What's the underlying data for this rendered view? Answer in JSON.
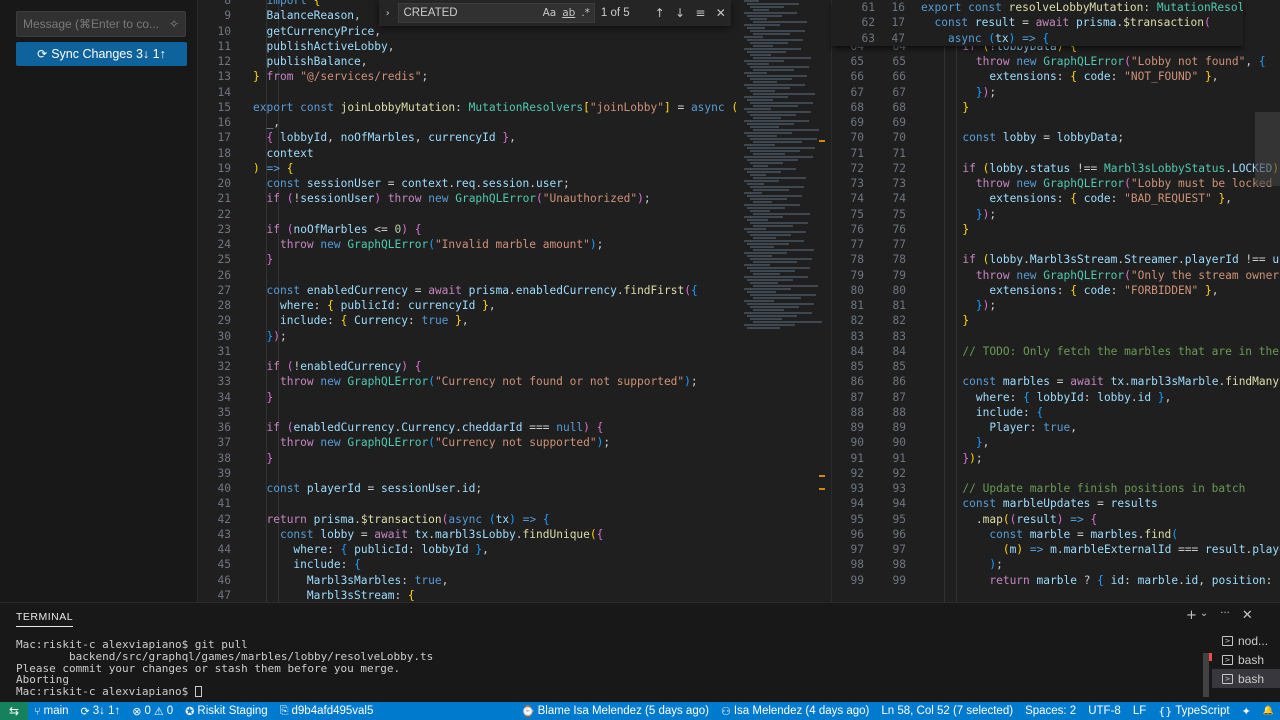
{
  "scm": {
    "message_placeholder": "Message (⌘Enter to co...",
    "sparkle_icon": "✧",
    "sync_icon": "⟳",
    "sync_label": "Sync Changes 3↓ 1↑"
  },
  "find": {
    "toggle_icon": "›",
    "query": "CREATED",
    "match_case": "Aa",
    "whole_word": "ab",
    "regex": ".*",
    "count": "1 of 5",
    "prev_icon": "↑",
    "next_icon": "↓",
    "selection_icon": "≡",
    "close_icon": "✕"
  },
  "left_editor": {
    "lines": [
      {
        "n": "8",
        "h": "  <span class=\"kw\">import</span> <span class=\"pn1\">{</span>"
      },
      {
        "n": "9",
        "h": "  <span class=\"vr\">BalanceReason</span>,"
      },
      {
        "n": "10",
        "h": "  <span class=\"vr\">getCurrencyPrice</span>,"
      },
      {
        "n": "11",
        "h": "  <span class=\"vr\">publishActiveLobby</span>,"
      },
      {
        "n": "12",
        "h": "  <span class=\"vr\">publishBalance</span>,"
      },
      {
        "n": "13",
        "h": "<span class=\"pn1\">}</span> <span class=\"ctl\">from</span> <span class=\"str\">\"@/services/redis\"</span>;"
      },
      {
        "n": "14",
        "h": ""
      },
      {
        "n": "15",
        "h": "<span class=\"kw\">export</span> <span class=\"kw\">const</span> <span class=\"fn\">joinLobbyMutation</span>: <span class=\"ty\">MutationResolvers</span><span class=\"pn1\">[</span><span class=\"str\">\"joinLobby\"</span><span class=\"pn1\">]</span> = <span class=\"kw\">async</span> <span class=\"pn1\">(</span>"
      },
      {
        "n": "16",
        "h": "  <span class=\"vr\">_</span>,"
      },
      {
        "n": "17",
        "h": "  <span class=\"pn2\">{</span> <span class=\"vr\">lobbyId</span>, <span class=\"vr\">noOfMarbles</span>, <span class=\"vr\">currencyId</span> <span class=\"pn2\">}</span>,"
      },
      {
        "n": "18",
        "h": "  <span class=\"vr\">context</span>"
      },
      {
        "n": "19",
        "h": "<span class=\"pn1\">)</span> <span class=\"kw\">=&gt;</span> <span class=\"pn1\">{</span>"
      },
      {
        "n": "20",
        "h": "  <span class=\"kw\">const</span> <span class=\"vr\">sessionUser</span> = <span class=\"vr\">context</span>.<span class=\"vr\">req</span>.<span class=\"vr\">session</span>.<span class=\"vr\">user</span>;"
      },
      {
        "n": "21",
        "h": "  <span class=\"ctl\">if</span> <span class=\"pn2\">(</span>!<span class=\"vr\">sessionUser</span><span class=\"pn2\">)</span> <span class=\"ctl\">throw</span> <span class=\"kw\">new</span> <span class=\"ty\">GraphQLError</span><span class=\"pn2\">(</span><span class=\"str\">\"Unauthorized\"</span><span class=\"pn2\">)</span>;"
      },
      {
        "n": "22",
        "h": ""
      },
      {
        "n": "23",
        "h": "  <span class=\"ctl\">if</span> <span class=\"pn2\">(</span><span class=\"vr\">noOfMarbles</span> &lt;= <span class=\"num\">0</span><span class=\"pn2\">)</span> <span class=\"pn2\">{</span>"
      },
      {
        "n": "24",
        "h": "    <span class=\"ctl\">throw</span> <span class=\"kw\">new</span> <span class=\"ty\">GraphQLError</span><span class=\"pn3\">(</span><span class=\"str\">\"Invalid marble amount\"</span><span class=\"pn3\">)</span>;"
      },
      {
        "n": "25",
        "h": "  <span class=\"pn2\">}</span>"
      },
      {
        "n": "26",
        "h": ""
      },
      {
        "n": "27",
        "h": "  <span class=\"kw\">const</span> <span class=\"vr\">enabledCurrency</span> = <span class=\"ctl\">await</span> <span class=\"vr\">prisma</span>.<span class=\"vr\">enabledCurrency</span>.<span class=\"fn\">findFirst</span><span class=\"pn2\">(</span><span class=\"pn3\">{</span>"
      },
      {
        "n": "28",
        "h": "    <span class=\"vr\">where</span>: <span class=\"pn1\">{</span> <span class=\"vr\">publicId</span>: <span class=\"vr\">currencyId</span> <span class=\"pn1\">}</span>,"
      },
      {
        "n": "29",
        "h": "    <span class=\"vr\">include</span>: <span class=\"pn1\">{</span> <span class=\"vr\">Currency</span>: <span class=\"kw\">true</span> <span class=\"pn1\">}</span>,"
      },
      {
        "n": "30",
        "h": "  <span class=\"pn3\">}</span><span class=\"pn2\">)</span>;"
      },
      {
        "n": "31",
        "h": ""
      },
      {
        "n": "32",
        "h": "  <span class=\"ctl\">if</span> <span class=\"pn2\">(</span>!<span class=\"vr\">enabledCurrency</span><span class=\"pn2\">)</span> <span class=\"pn2\">{</span>"
      },
      {
        "n": "33",
        "h": "    <span class=\"ctl\">throw</span> <span class=\"kw\">new</span> <span class=\"ty\">GraphQLError</span><span class=\"pn3\">(</span><span class=\"str\">\"Currency not found or not supported\"</span><span class=\"pn3\">)</span>;"
      },
      {
        "n": "34",
        "h": "  <span class=\"pn2\">}</span>"
      },
      {
        "n": "35",
        "h": ""
      },
      {
        "n": "36",
        "h": "  <span class=\"ctl\">if</span> <span class=\"pn2\">(</span><span class=\"vr\">enabledCurrency</span>.<span class=\"vr\">Currency</span>.<span class=\"vr\">cheddarId</span> === <span class=\"kw\">null</span><span class=\"pn2\">)</span> <span class=\"pn2\">{</span>"
      },
      {
        "n": "37",
        "h": "    <span class=\"ctl\">throw</span> <span class=\"kw\">new</span> <span class=\"ty\">GraphQLError</span><span class=\"pn3\">(</span><span class=\"str\">\"Currency not supported\"</span><span class=\"pn3\">)</span>;"
      },
      {
        "n": "38",
        "h": "  <span class=\"pn2\">}</span>"
      },
      {
        "n": "39",
        "h": ""
      },
      {
        "n": "40",
        "h": "  <span class=\"kw\">const</span> <span class=\"vr\">playerId</span> = <span class=\"vr\">sessionUser</span>.<span class=\"vr\">id</span>;"
      },
      {
        "n": "41",
        "h": ""
      },
      {
        "n": "42",
        "h": "  <span class=\"ctl\">return</span> <span class=\"vr\">prisma</span>.<span class=\"fn\">$transaction</span><span class=\"pn2\">(</span><span class=\"kw\">async</span> <span class=\"pn3\">(</span><span class=\"vr\">tx</span><span class=\"pn3\">)</span> <span class=\"kw\">=&gt;</span> <span class=\"pn3\">{</span>"
      },
      {
        "n": "43",
        "h": "    <span class=\"kw\">const</span> <span class=\"vr\">lobby</span> = <span class=\"ctl\">await</span> <span class=\"vr\">tx</span>.<span class=\"vr\">marbl3sLobby</span>.<span class=\"fn\">findUnique</span><span class=\"pn1\">(</span><span class=\"pn2\">{</span>"
      },
      {
        "n": "44",
        "h": "      <span class=\"vr\">where</span>: <span class=\"pn3\">{</span> <span class=\"vr\">publicId</span>: <span class=\"vr\">lobbyId</span> <span class=\"pn3\">}</span>,"
      },
      {
        "n": "45",
        "h": "      <span class=\"vr\">include</span>: <span class=\"pn3\">{</span>"
      },
      {
        "n": "46",
        "h": "        <span class=\"vr\">Marbl3sMarbles</span>: <span class=\"kw\">true</span>,"
      },
      {
        "n": "47",
        "h": "        <span class=\"vr\">Marbl3sStream</span>: <span class=\"pn1\">{</span>"
      }
    ]
  },
  "right_editor": {
    "sticky": [
      {
        "n1": "61",
        "n2": "16",
        "h": "<span class=\"kw\">export</span> <span class=\"kw\">const</span> <span class=\"fn\">resolveLobbyMutation</span>: <span class=\"ty\">MutationResolvers</span>"
      },
      {
        "n1": "62",
        "n2": "17",
        "h": "  <span class=\"kw\">const</span> <span class=\"vr\">result</span> = <span class=\"ctl\">await</span> <span class=\"vr\">prisma</span>.<span class=\"fn\">$transaction</span><span class=\"pn2\">(</span>"
      },
      {
        "n1": "63",
        "n2": "47",
        "h": "    <span class=\"kw\">async</span> <span class=\"pn3\">(</span><span class=\"vr\">tx</span><span class=\"pn3\">)</span> <span class=\"kw\">=&gt;</span> <span class=\"pn3\">{</span>"
      }
    ],
    "lines": [
      {
        "n1": "61",
        "n2": "",
        "h": ""
      },
      {
        "n1": "62",
        "n2": "",
        "h": ""
      },
      {
        "n1": "63",
        "n2": "",
        "h": ""
      },
      {
        "n1": "64",
        "n2": "64",
        "h": "      <span class=\"ctl\">if</span> <span class=\"pn1\">(</span>!<span class=\"vr\">lobbyData</span><span class=\"pn1\">)</span> <span class=\"pn1\">{</span>"
      },
      {
        "n1": "65",
        "n2": "65",
        "h": "        <span class=\"ctl\">throw</span> <span class=\"kw\">new</span> <span class=\"ty\">GraphQLError</span><span class=\"pn2\">(</span><span class=\"str\">\"Lobby not found\"</span>, <span class=\"pn3\">{</span>"
      },
      {
        "n1": "66",
        "n2": "66",
        "h": "          <span class=\"vr\">extensions</span>: <span class=\"pn1\">{</span> <span class=\"vr\">code</span>: <span class=\"str\">\"NOT_FOUND\"</span> <span class=\"pn1\">}</span>,"
      },
      {
        "n1": "67",
        "n2": "67",
        "h": "        <span class=\"pn3\">}</span><span class=\"pn2\">)</span>;"
      },
      {
        "n1": "68",
        "n2": "68",
        "h": "      <span class=\"pn1\">}</span>"
      },
      {
        "n1": "69",
        "n2": "69",
        "h": ""
      },
      {
        "n1": "70",
        "n2": "70",
        "h": "      <span class=\"kw\">const</span> <span class=\"vr\">lobby</span> = <span class=\"vr\">lobbyData</span>;"
      },
      {
        "n1": "71",
        "n2": "71",
        "h": ""
      },
      {
        "n1": "72",
        "n2": "72",
        "h": "      <span class=\"ctl\">if</span> <span class=\"pn1\">(</span><span class=\"vr\">lobby</span>.<span class=\"vr\">status</span> !== <span class=\"ty\">Marbl3sLobbyStatus</span>.<span class=\"vr\">LOCKED</span><span class=\"pn1\">)</span> <span class=\"pn1\">{</span>"
      },
      {
        "n1": "73",
        "n2": "73",
        "h": "        <span class=\"ctl\">throw</span> <span class=\"kw\">new</span> <span class=\"ty\">GraphQLError</span><span class=\"pn2\">(</span><span class=\"str\">\"Lobby must be locked b</span>"
      },
      {
        "n1": "74",
        "n2": "74",
        "h": "          <span class=\"vr\">extensions</span>: <span class=\"pn1\">{</span> <span class=\"vr\">code</span>: <span class=\"str\">\"BAD_REQUEST\"</span> <span class=\"pn1\">}</span>,"
      },
      {
        "n1": "75",
        "n2": "75",
        "h": "        <span class=\"pn3\">}</span><span class=\"pn2\">)</span>;"
      },
      {
        "n1": "76",
        "n2": "76",
        "h": "      <span class=\"pn1\">}</span>"
      },
      {
        "n1": "77",
        "n2": "77",
        "h": ""
      },
      {
        "n1": "78",
        "n2": "78",
        "h": "      <span class=\"ctl\">if</span> <span class=\"pn1\">(</span><span class=\"vr\">lobby</span>.<span class=\"vr\">Marbl3sStream</span>.<span class=\"vr\">Streamer</span>.<span class=\"vr\">playerId</span> !== <span class=\"vr\">us</span>"
      },
      {
        "n1": "79",
        "n2": "79",
        "h": "        <span class=\"ctl\">throw</span> <span class=\"kw\">new</span> <span class=\"ty\">GraphQLError</span><span class=\"pn2\">(</span><span class=\"str\">\"Only the stream owner</span>"
      },
      {
        "n1": "80",
        "n2": "80",
        "h": "          <span class=\"vr\">extensions</span>: <span class=\"pn1\">{</span> <span class=\"vr\">code</span>: <span class=\"str\">\"FORBIDDEN\"</span> <span class=\"pn1\">}</span>,"
      },
      {
        "n1": "81",
        "n2": "81",
        "h": "        <span class=\"pn3\">}</span><span class=\"pn2\">)</span>;"
      },
      {
        "n1": "82",
        "n2": "82",
        "h": "      <span class=\"pn1\">}</span>"
      },
      {
        "n1": "83",
        "n2": "83",
        "h": ""
      },
      {
        "n1": "84",
        "n2": "84",
        "h": "      <span class=\"cm\">// TODO: Only fetch the marbles that are in the</span>"
      },
      {
        "n1": "85",
        "n2": "85",
        "h": ""
      },
      {
        "n1": "86",
        "n2": "86",
        "h": "      <span class=\"kw\">const</span> <span class=\"vr\">marbles</span> = <span class=\"ctl\">await</span> <span class=\"vr\">tx</span>.<span class=\"vr\">marbl3sMarble</span>.<span class=\"fn\">findMany</span><span class=\"pn1\">(</span>"
      },
      {
        "n1": "87",
        "n2": "87",
        "h": "        <span class=\"vr\">where</span>: <span class=\"pn3\">{</span> <span class=\"vr\">lobbyId</span>: <span class=\"vr\">lobby</span>.<span class=\"vr\">id</span> <span class=\"pn3\">}</span>,"
      },
      {
        "n1": "88",
        "n2": "88",
        "h": "        <span class=\"vr\">include</span>: <span class=\"pn3\">{</span>"
      },
      {
        "n1": "89",
        "n2": "89",
        "h": "          <span class=\"vr\">Player</span>: <span class=\"kw\">true</span>,"
      },
      {
        "n1": "90",
        "n2": "90",
        "h": "        <span class=\"pn3\">}</span>,"
      },
      {
        "n1": "91",
        "n2": "91",
        "h": "      <span class=\"pn2\">}</span><span class=\"pn1\">)</span>;"
      },
      {
        "n1": "92",
        "n2": "92",
        "h": ""
      },
      {
        "n1": "93",
        "n2": "93",
        "h": "      <span class=\"cm\">// Update marble finish positions in batch</span>"
      },
      {
        "n1": "94",
        "n2": "94",
        "h": "      <span class=\"kw\">const</span> <span class=\"vr\">marbleUpdates</span> = <span class=\"vr\">results</span>"
      },
      {
        "n1": "95",
        "n2": "95",
        "h": "        .<span class=\"fn\">map</span><span class=\"pn1\">(</span><span class=\"pn2\">(</span><span class=\"vr\">result</span><span class=\"pn2\">)</span> <span class=\"kw\">=&gt;</span> <span class=\"pn2\">{</span>"
      },
      {
        "n1": "96",
        "n2": "96",
        "h": "          <span class=\"kw\">const</span> <span class=\"vr\">marble</span> = <span class=\"vr\">marbles</span>.<span class=\"fn\">find</span><span class=\"pn3\">(</span>"
      },
      {
        "n1": "97",
        "n2": "97",
        "h": "            <span class=\"pn1\">(</span><span class=\"vr\">m</span><span class=\"pn1\">)</span> <span class=\"kw\">=&gt;</span> <span class=\"vr\">m</span>.<span class=\"vr\">marbleExternalId</span> === <span class=\"vr\">result</span>.<span class=\"vr\">playe</span>"
      },
      {
        "n1": "98",
        "n2": "98",
        "h": "          <span class=\"pn3\">)</span>;"
      },
      {
        "n1": "99",
        "n2": "99",
        "h": "          <span class=\"ctl\">return</span> <span class=\"vr\">marble</span> ? <span class=\"pn3\">{</span> <span class=\"vr\">id</span>: <span class=\"vr\">marble</span>.<span class=\"vr\">id</span>, <span class=\"vr\">position</span>: <span class=\"vr\">r</span>"
      }
    ]
  },
  "terminal": {
    "tab_label": "TERMINAL",
    "add_icon": "+",
    "dropdown_icon": "⌄",
    "more_icon": "···",
    "close_icon": "✕",
    "output": [
      "Mac:riskit-c alexviapiano$ git pull",
      "        backend/src/graphql/games/marbles/lobby/resolveLobby.ts",
      "Please commit your changes or stash them before you merge.",
      "Aborting",
      "Mac:riskit-c alexviapiano$ "
    ],
    "sessions": [
      "nod...",
      "bash",
      "bash"
    ]
  },
  "status_bar": {
    "remote_icon": "⇆",
    "branch_icon": "⑂",
    "branch": "main",
    "sync_icon": "⟳",
    "sync": "3↓ 1↑",
    "errors_icon": "⊗",
    "errors": "0",
    "warnings_icon": "⚠",
    "warnings": "0",
    "env_icon": "✪",
    "env": "Riskit Staging",
    "commit_icon": "⎘",
    "commit": "d9b4afd495val5",
    "blame_icon": "⌚",
    "blame": "Blame Isa Melendez (5 days ago)",
    "author_icon": "⚇",
    "author": "Isa Melendez (4 days ago)",
    "cursor": "Ln 58, Col 52 (7 selected)",
    "spaces": "Spaces: 2",
    "encoding": "UTF-8",
    "eol": "LF",
    "lang_icon": "{}",
    "language": "TypeScript",
    "copilot_icon": "✦",
    "bell_icon": "🔔"
  }
}
